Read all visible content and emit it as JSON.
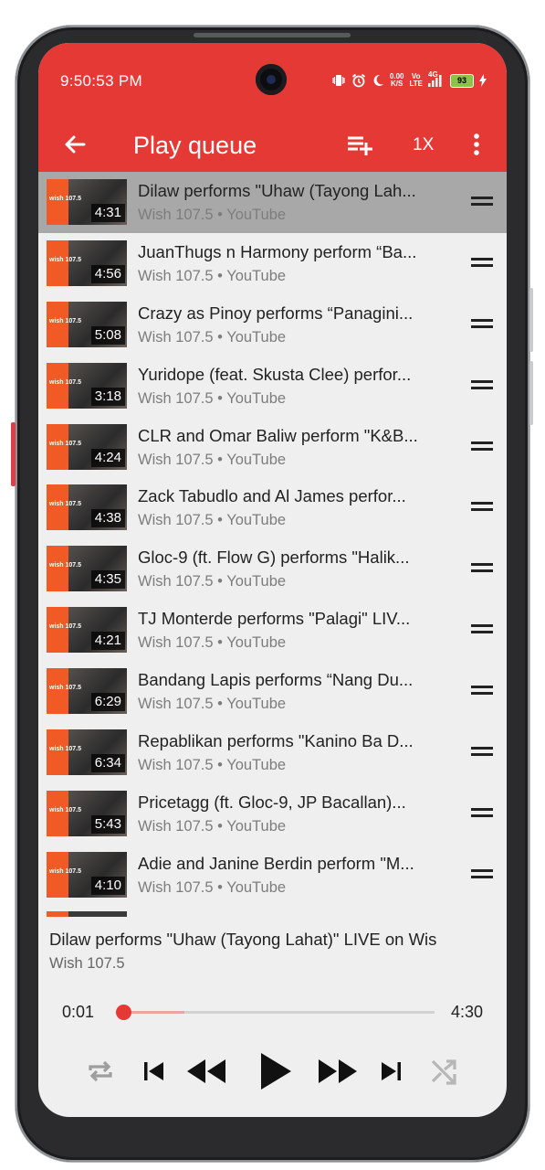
{
  "status_bar": {
    "time": "9:50:53 PM",
    "net_speed_value": "0.00",
    "net_speed_unit": "K/S",
    "volte_top": "Vo",
    "volte_bottom": "LTE",
    "network": "4G",
    "battery": "93"
  },
  "toolbar": {
    "title": "Play queue",
    "speed_label": "1X"
  },
  "queue": [
    {
      "title": "Dilaw performs \"Uhaw (Tayong Lah...",
      "channel": "Wish 107.5",
      "source": "YouTube",
      "duration": "4:31",
      "current": true
    },
    {
      "title": "JuanThugs n Harmony perform “Ba...",
      "channel": "Wish 107.5",
      "source": "YouTube",
      "duration": "4:56"
    },
    {
      "title": "Crazy as Pinoy performs “Panagini...",
      "channel": "Wish 107.5",
      "source": "YouTube",
      "duration": "5:08"
    },
    {
      "title": "Yuridope (feat. Skusta Clee) perfor...",
      "channel": "Wish 107.5",
      "source": "YouTube",
      "duration": "3:18"
    },
    {
      "title": "CLR and Omar Baliw perform \"K&B...",
      "channel": "Wish 107.5",
      "source": "YouTube",
      "duration": "4:24"
    },
    {
      "title": "Zack Tabudlo and Al James perfor...",
      "channel": "Wish 107.5",
      "source": "YouTube",
      "duration": "4:38"
    },
    {
      "title": "Gloc-9 (ft. Flow G) performs \"Halik...",
      "channel": "Wish 107.5",
      "source": "YouTube",
      "duration": "4:35"
    },
    {
      "title": "TJ Monterde performs \"Palagi\" LIV...",
      "channel": "Wish 107.5",
      "source": "YouTube",
      "duration": "4:21"
    },
    {
      "title": "Bandang Lapis performs “Nang Du...",
      "channel": "Wish 107.5",
      "source": "YouTube",
      "duration": "6:29"
    },
    {
      "title": "Repablikan performs \"Kanino Ba D...",
      "channel": "Wish 107.5",
      "source": "YouTube",
      "duration": "6:34"
    },
    {
      "title": "Pricetagg (ft. Gloc-9, JP Bacallan)...",
      "channel": "Wish 107.5",
      "source": "YouTube",
      "duration": "5:43"
    },
    {
      "title": "Adie and Janine Berdin perform \"M...",
      "channel": "Wish 107.5",
      "source": "YouTube",
      "duration": "4:10"
    }
  ],
  "thumb_logo": "wish 107.5",
  "now_playing": {
    "title": "Dilaw performs \"Uhaw (Tayong Lahat)\" LIVE on Wis",
    "artist": "Wish 107.5",
    "current_time": "0:01",
    "total_time": "4:30",
    "progress_fraction": 0.004,
    "buffer_fraction": 0.2
  },
  "controls": [
    "repeat-icon",
    "skip-previous-icon",
    "rewind-icon",
    "play-icon",
    "fast-forward-icon",
    "skip-next-icon",
    "shuffle-icon"
  ],
  "colors": {
    "accent": "#e53935",
    "current_row": "#a8a8a8",
    "background": "#efefef",
    "thumb_brand": "#f15a24"
  }
}
